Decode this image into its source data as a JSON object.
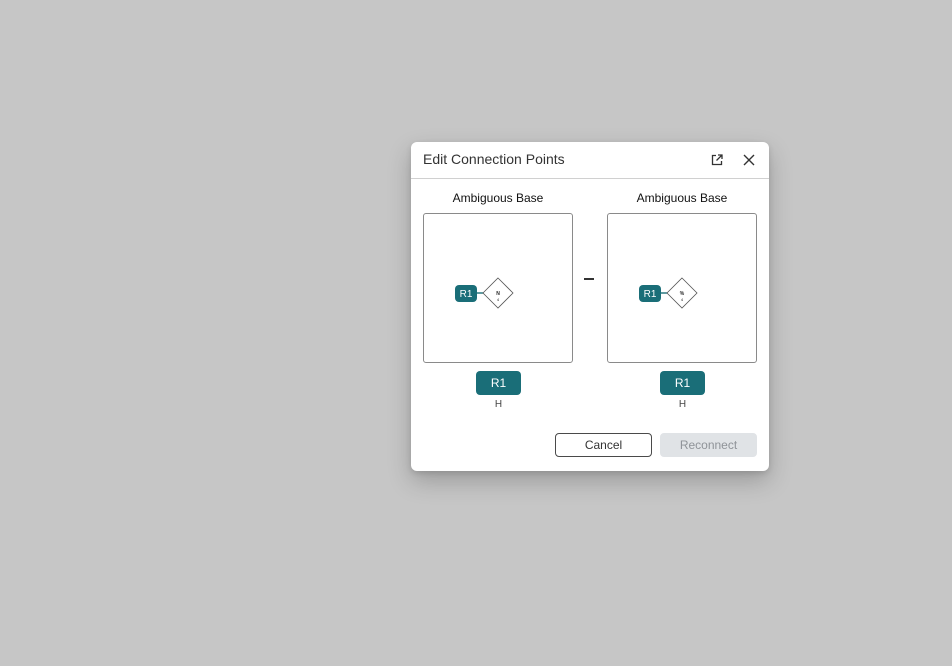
{
  "dialog": {
    "title": "Edit Connection Points",
    "open_external_icon": "open-in-new-window-icon",
    "close_icon": "close-icon"
  },
  "left": {
    "label": "Ambiguous Base",
    "attachment_badge": "R1",
    "monomer_label": "N",
    "monomer_sub": "4",
    "point_button": "R1",
    "point_leaving_group": "H"
  },
  "separator": "–",
  "right": {
    "label": "Ambiguous Base",
    "attachment_badge": "R1",
    "monomer_label": "%",
    "monomer_sub": "4",
    "point_button": "R1",
    "point_leaving_group": "H"
  },
  "footer": {
    "cancel_label": "Cancel",
    "reconnect_label": "Reconnect"
  },
  "colors": {
    "accent": "#1a6e78",
    "backdrop": "#c6c6c6",
    "disabled_bg": "#e0e3e6",
    "disabled_text": "#8f9398"
  }
}
